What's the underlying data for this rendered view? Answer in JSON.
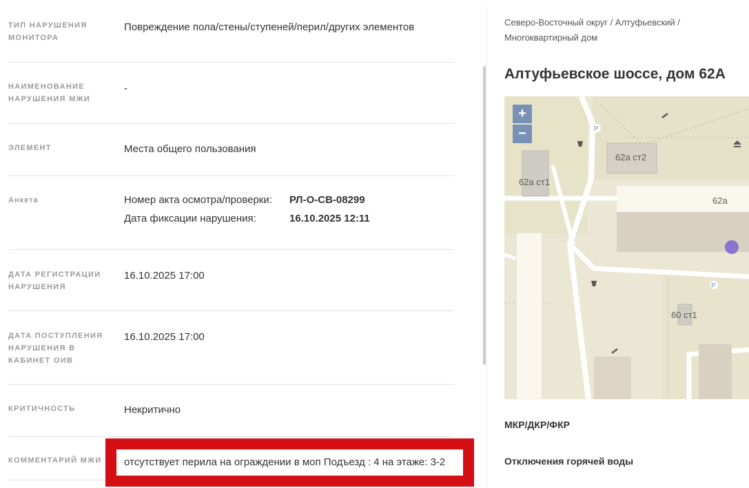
{
  "details": {
    "violation_type": {
      "label": "Тип нарушения монитора",
      "value": "Повреждение пола/стены/ступеней/перил/других элементов"
    },
    "mzhi_name": {
      "label": "Наименование нарушения МЖИ",
      "value": "-"
    },
    "element": {
      "label": "Элемент",
      "value": "Места общего пользования"
    },
    "anketa": {
      "label": "Анкета",
      "act_label": "Номер акта осмотра/проверки:",
      "act_value": "РЛ-О-СВ-08299",
      "date_label": "Дата фиксации нарушения:",
      "date_value": "16.10.2025 12:11"
    },
    "registration_date": {
      "label": "Дата регистрации нарушения",
      "value": "16.10.2025 17:00"
    },
    "receipt_date": {
      "label": "Дата поступления нарушения в кабинет ОИВ",
      "value": "16.10.2025 17:00"
    },
    "criticality": {
      "label": "Критичность",
      "value": "Некритично"
    },
    "mzhi_comment": {
      "label": "Комментарий МЖИ",
      "value": "отсутствует перила на ограждении в моп Подъезд : 4 на этаже: 3-2"
    }
  },
  "location": {
    "breadcrumb": "Северо-Восточный округ / Алтуфьевский / Многоквартирный дом",
    "address": "Алтуфьевское шоссе, дом 62А"
  },
  "map": {
    "zoom_in": "+",
    "zoom_out": "−",
    "labels": {
      "b1": "62а ст2",
      "b2": "62а ст1",
      "b3": "62а",
      "b4": "60 ст1",
      "parking": "P"
    },
    "marker_color": "#8b74cf"
  },
  "sections": {
    "mkr": "МКР/ДКР/ФКР",
    "hot_water": "Отключения горячей воды"
  },
  "colors": {
    "highlight": "#d40f14",
    "zoom_bg": "#7891b4"
  }
}
